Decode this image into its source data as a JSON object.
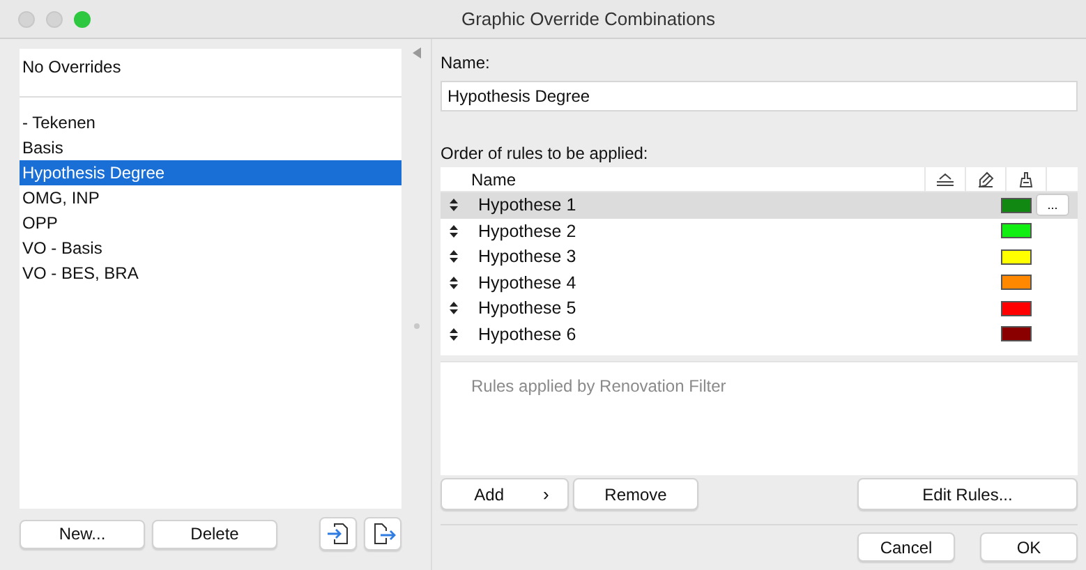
{
  "window": {
    "title": "Graphic Override Combinations"
  },
  "combinations": {
    "header_item": "No Overrides",
    "items": [
      {
        "label": "- Tekenen",
        "selected": false
      },
      {
        "label": "Basis",
        "selected": false
      },
      {
        "label": "Hypothesis Degree",
        "selected": true
      },
      {
        "label": "OMG, INP",
        "selected": false
      },
      {
        "label": "OPP",
        "selected": false
      },
      {
        "label": "VO - Basis",
        "selected": false
      },
      {
        "label": "VO - BES, BRA",
        "selected": false
      }
    ],
    "buttons": [
      "New...",
      "Delete"
    ]
  },
  "name_field": {
    "label": "Name:",
    "value": "Hypothesis Degree"
  },
  "rules": {
    "label": "Order of rules to be applied:",
    "columns": [
      "Name"
    ],
    "rows": [
      {
        "name": "Hypothese 1",
        "color": "#118811",
        "selected": true,
        "more": "..."
      },
      {
        "name": "Hypothese 2",
        "color": "#11ee11",
        "selected": false
      },
      {
        "name": "Hypothese 3",
        "color": "#ffff00",
        "selected": false
      },
      {
        "name": "Hypothese 4",
        "color": "#ff8800",
        "selected": false
      },
      {
        "name": "Hypothese 5",
        "color": "#ff0000",
        "selected": false
      },
      {
        "name": "Hypothese 6",
        "color": "#8a0000",
        "selected": false
      }
    ],
    "renovation_note": "Rules applied by Renovation Filter",
    "add_button": "Add",
    "add_caret": "›",
    "remove_button": "Remove",
    "edit_button": "Edit Rules..."
  },
  "dialog_buttons": [
    "Cancel",
    "OK"
  ]
}
